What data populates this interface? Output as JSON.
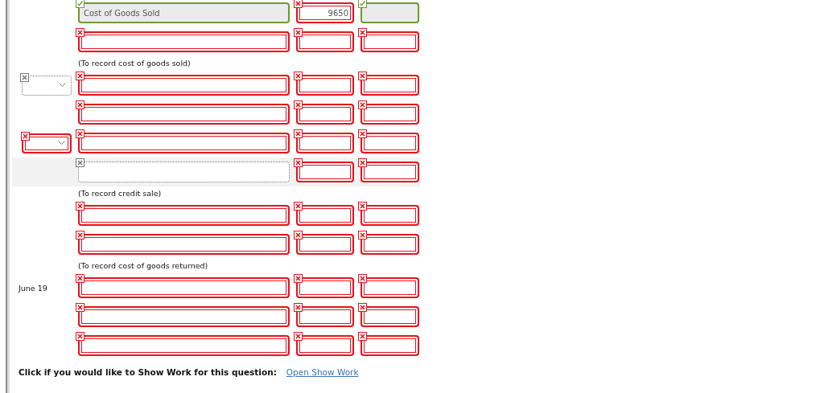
{
  "entries": [
    {
      "kind": "entry",
      "shaded": false,
      "account": {
        "value": "Cost of Goods Sold",
        "graded": true,
        "correct": true
      },
      "debit": {
        "value": "9650",
        "graded": true,
        "correct": false
      },
      "credit": {
        "graded": true,
        "correct": true
      }
    },
    {
      "kind": "entry",
      "shaded": false,
      "account": {
        "graded": true,
        "correct": false
      },
      "debit": {
        "graded": true,
        "correct": false
      },
      "credit": {
        "graded": true,
        "correct": false
      }
    },
    {
      "kind": "note",
      "text": "(To record cost of goods sold)"
    },
    {
      "kind": "entry",
      "shaded": false,
      "date": {
        "kind": "dropdown",
        "graded": false
      },
      "account": {
        "graded": true,
        "correct": false
      },
      "debit": {
        "graded": true,
        "correct": false
      },
      "credit": {
        "graded": true,
        "correct": false
      }
    },
    {
      "kind": "entry",
      "shaded": false,
      "account": {
        "graded": true,
        "correct": false
      },
      "debit": {
        "graded": true,
        "correct": false
      },
      "credit": {
        "graded": true,
        "correct": false
      }
    },
    {
      "kind": "entry",
      "shaded": false,
      "date": {
        "kind": "dropdown",
        "graded": true,
        "correct": false
      },
      "account": {
        "graded": true,
        "correct": false
      },
      "debit": {
        "graded": true,
        "correct": false
      },
      "credit": {
        "graded": true,
        "correct": false
      }
    },
    {
      "kind": "entry",
      "shaded": true,
      "account": {
        "graded": false
      },
      "debit": {
        "graded": true,
        "correct": false
      },
      "credit": {
        "graded": true,
        "correct": false
      }
    },
    {
      "kind": "note",
      "text": "(To record credit sale)"
    },
    {
      "kind": "entry",
      "shaded": false,
      "account": {
        "graded": true,
        "correct": false
      },
      "debit": {
        "graded": true,
        "correct": false
      },
      "credit": {
        "graded": true,
        "correct": false
      }
    },
    {
      "kind": "entry",
      "shaded": false,
      "account": {
        "graded": true,
        "correct": false
      },
      "debit": {
        "graded": true,
        "correct": false
      },
      "credit": {
        "graded": true,
        "correct": false
      }
    },
    {
      "kind": "note",
      "text": "(To record cost of goods returned)"
    },
    {
      "kind": "entry",
      "shaded": false,
      "date": {
        "kind": "text",
        "text": "June 19"
      },
      "account": {
        "graded": true,
        "correct": false
      },
      "debit": {
        "graded": true,
        "correct": false
      },
      "credit": {
        "graded": true,
        "correct": false
      }
    },
    {
      "kind": "entry",
      "shaded": false,
      "account": {
        "graded": true,
        "correct": false
      },
      "debit": {
        "graded": true,
        "correct": false
      },
      "credit": {
        "graded": true,
        "correct": false
      }
    },
    {
      "kind": "entry",
      "shaded": false,
      "account": {
        "graded": true,
        "correct": false
      },
      "debit": {
        "graded": true,
        "correct": false
      },
      "credit": {
        "graded": true,
        "correct": false
      }
    }
  ],
  "footer": {
    "prompt": "Click if you would like to Show Work for this question:",
    "link": "Open Show Work"
  }
}
